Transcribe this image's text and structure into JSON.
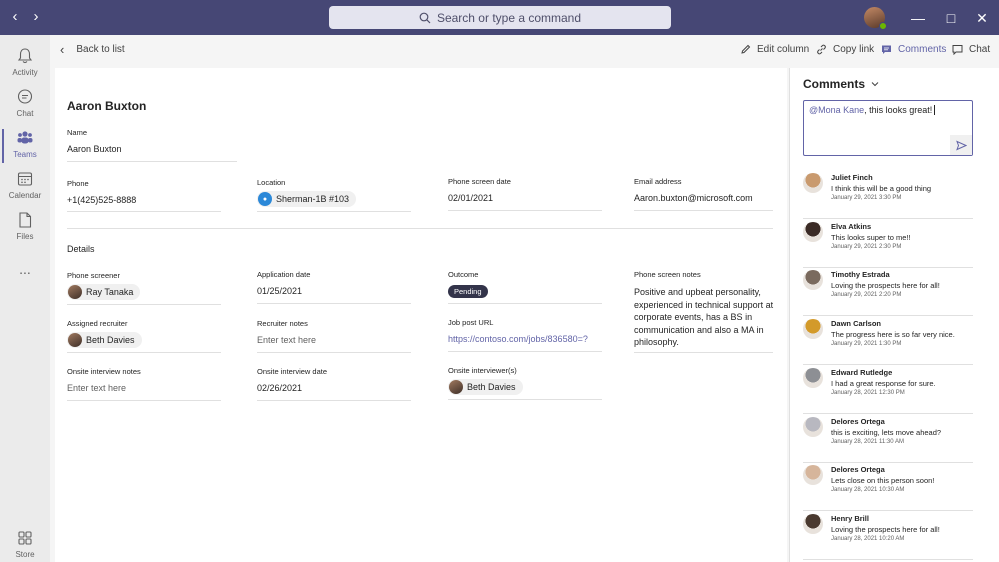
{
  "titlebar": {
    "search_placeholder": "Search or type a command"
  },
  "rail": {
    "items": [
      {
        "label": "Activity"
      },
      {
        "label": "Chat"
      },
      {
        "label": "Teams"
      },
      {
        "label": "Calendar"
      },
      {
        "label": "Files"
      },
      {
        "label": "..."
      },
      {
        "label": "Store"
      }
    ]
  },
  "toolbar": {
    "back": "Back to list",
    "edit_column": "Edit column",
    "copy_link": "Copy link",
    "comments": "Comments",
    "chat": "Chat"
  },
  "record": {
    "title": "Aaron Buxton",
    "name_label": "Name",
    "name_value": "Aaron Buxton",
    "phone_label": "Phone",
    "phone_value": "+1(425)525-8888",
    "location_label": "Location",
    "location_value": "Sherman-1B #103",
    "phone_screen_date_label": "Phone screen date",
    "phone_screen_date_value": "02/01/2021",
    "email_label": "Email address",
    "email_value": "Aaron.buxton@microsoft.com",
    "details_heading": "Details",
    "phone_screener_label": "Phone screener",
    "phone_screener_value": "Ray Tanaka",
    "application_date_label": "Application date",
    "application_date_value": "01/25/2021",
    "outcome_label": "Outcome",
    "outcome_value": "Pending",
    "phone_screen_notes_label": "Phone screen notes",
    "phone_screen_notes_value": "Positive and upbeat personality, experienced in technical support at corporate events, has a BS in communication and also a MA in philosophy.",
    "assigned_recruiter_label": "Assigned recruiter",
    "assigned_recruiter_value": "Beth Davies",
    "recruiter_notes_label": "Recruiter notes",
    "recruiter_notes_placeholder": "Enter text here",
    "job_post_url_label": "Job post URL",
    "job_post_url_value": "https://contoso.com/jobs/836580=?",
    "onsite_notes_label": "Onsite interview notes",
    "onsite_notes_placeholder": "Enter text here",
    "onsite_date_label": "Onsite interview date",
    "onsite_date_value": "02/26/2021",
    "onsite_interviewers_label": "Onsite interviewer(s)",
    "onsite_interviewers_value": "Beth Davies"
  },
  "comments": {
    "title": "Comments",
    "draft_mention": "@Mona Kane",
    "draft_text": ", this looks great!",
    "items": [
      {
        "name": "Juliet Finch",
        "text": "I think this will be a good thing",
        "date": "January 29, 2021 3:30 PM",
        "color": "#c99a6e"
      },
      {
        "name": "Elva Atkins",
        "text": "This looks super to me!!",
        "date": "January 29, 2021 2:30 PM",
        "color": "#3b2b26"
      },
      {
        "name": "Timothy Estrada",
        "text": "Loving the prospects here for all!",
        "date": "January 29, 2021 2:20 PM",
        "color": "#7a6a5e"
      },
      {
        "name": "Dawn Carlson",
        "text": "The progress here is so far very nice.",
        "date": "January 29, 2021 1:30 PM",
        "color": "#d39a2a"
      },
      {
        "name": "Edward Rutledge",
        "text": "I had a great response for sure.",
        "date": "January 28, 2021 12:30 PM",
        "color": "#8d8f94"
      },
      {
        "name": "Delores Ortega",
        "text": "this is exciting, lets move ahead?",
        "date": "January 28, 2021 11:30 AM",
        "color": "#b8b8c0"
      },
      {
        "name": "Delores Ortega",
        "text": "Lets close on this person soon!",
        "date": "January 28, 2021 10:30 AM",
        "color": "#d6b59b"
      },
      {
        "name": "Henry Brill",
        "text": "Loving the prospects here for all!",
        "date": "January 28, 2021 10:20 AM",
        "color": "#4a3a30"
      }
    ]
  },
  "colors": {
    "accent": "#6264a7",
    "titlebar": "#464775"
  }
}
